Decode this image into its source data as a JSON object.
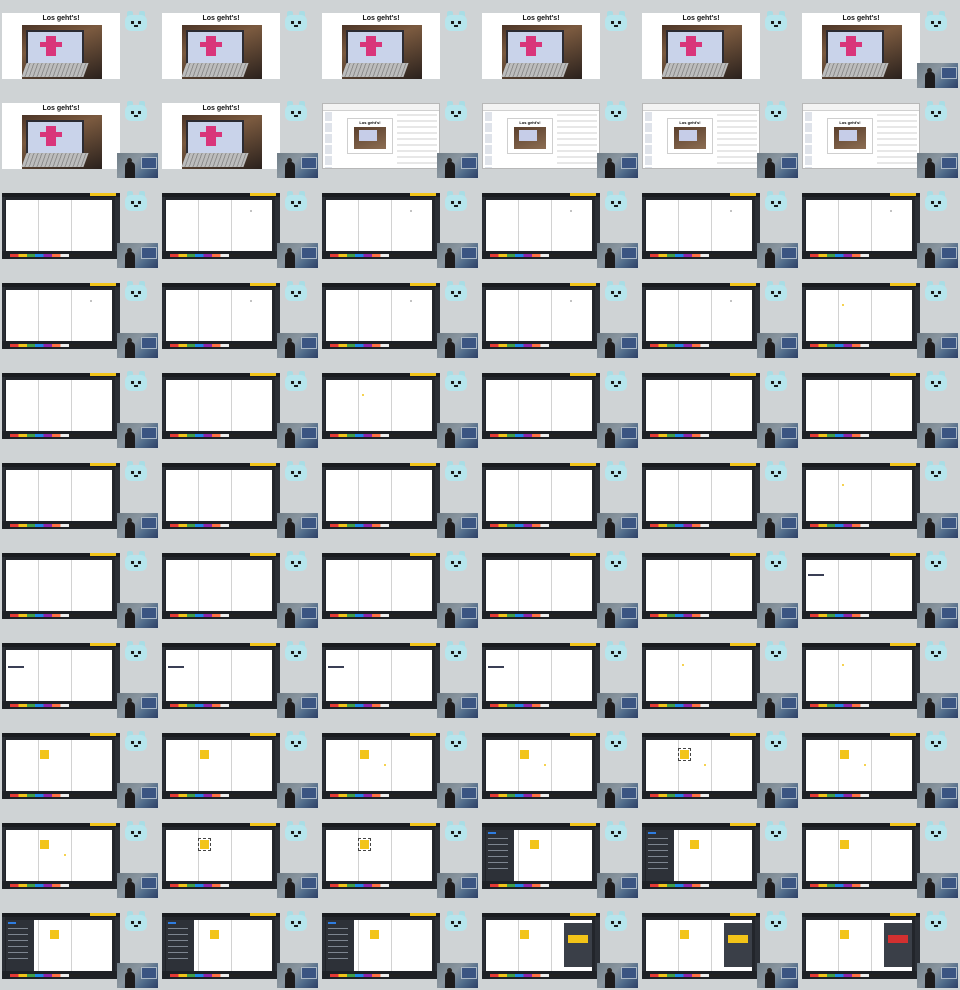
{
  "title_text": "Los geht's!",
  "colors": {
    "background": "#cfd3d5",
    "accent_yellow": "#f2c418",
    "board_dark": "#22252b",
    "mascot": "#b6e5ec",
    "marker_dot": "#b0b0b0",
    "yellow_dot": "#f2c418",
    "dialog_red": "#d23030"
  },
  "grid": {
    "columns": 6,
    "rows": 11,
    "cells": [
      {
        "type": "title",
        "cam": false
      },
      {
        "type": "title",
        "cam": false
      },
      {
        "type": "title",
        "cam": false
      },
      {
        "type": "title",
        "cam": false
      },
      {
        "type": "title",
        "cam": false
      },
      {
        "type": "title",
        "cam": true
      },
      {
        "type": "title",
        "cam": true
      },
      {
        "type": "title",
        "cam": true
      },
      {
        "type": "editor",
        "cam": true
      },
      {
        "type": "editor",
        "cam": true
      },
      {
        "type": "editor",
        "cam": true
      },
      {
        "type": "editor",
        "cam": true
      },
      {
        "type": "board",
        "cam": true
      },
      {
        "type": "board",
        "cam": true,
        "dot": "gray"
      },
      {
        "type": "board",
        "cam": true,
        "dot": "gray"
      },
      {
        "type": "board",
        "cam": true,
        "dot": "gray"
      },
      {
        "type": "board",
        "cam": true,
        "dot": "gray"
      },
      {
        "type": "board",
        "cam": true,
        "dot": "gray"
      },
      {
        "type": "board",
        "cam": true,
        "dot": "gray"
      },
      {
        "type": "board",
        "cam": true,
        "dot": "gray"
      },
      {
        "type": "board",
        "cam": true,
        "dot": "gray"
      },
      {
        "type": "board",
        "cam": true,
        "dot": "gray"
      },
      {
        "type": "board",
        "cam": true,
        "dot": "gray"
      },
      {
        "type": "board",
        "cam": true,
        "dot": "yellow"
      },
      {
        "type": "board",
        "cam": true
      },
      {
        "type": "board",
        "cam": true
      },
      {
        "type": "board",
        "cam": true,
        "dot": "yellow"
      },
      {
        "type": "board",
        "cam": true
      },
      {
        "type": "board",
        "cam": true
      },
      {
        "type": "board",
        "cam": true
      },
      {
        "type": "board",
        "cam": true
      },
      {
        "type": "board",
        "cam": true
      },
      {
        "type": "board",
        "cam": true
      },
      {
        "type": "board",
        "cam": true
      },
      {
        "type": "board",
        "cam": true
      },
      {
        "type": "board",
        "cam": true,
        "dot": "yellow"
      },
      {
        "type": "board",
        "cam": true
      },
      {
        "type": "board",
        "cam": true
      },
      {
        "type": "board",
        "cam": true
      },
      {
        "type": "board",
        "cam": true
      },
      {
        "type": "board",
        "cam": true
      },
      {
        "type": "board",
        "cam": true,
        "stroke": true
      },
      {
        "type": "board",
        "cam": true,
        "stroke": true
      },
      {
        "type": "board",
        "cam": true,
        "stroke": true
      },
      {
        "type": "board",
        "cam": true,
        "stroke": true
      },
      {
        "type": "board",
        "cam": true,
        "stroke": true
      },
      {
        "type": "board",
        "cam": true,
        "dot": "yellow"
      },
      {
        "type": "board",
        "cam": true,
        "dot": "yellow"
      },
      {
        "type": "board",
        "cam": true,
        "square": true
      },
      {
        "type": "board",
        "cam": true,
        "square": true
      },
      {
        "type": "board",
        "cam": true,
        "square": true,
        "dot": "yellow"
      },
      {
        "type": "board",
        "cam": true,
        "square": true,
        "dot": "yellow"
      },
      {
        "type": "board",
        "cam": true,
        "square": "sel",
        "dot": "yellow"
      },
      {
        "type": "board",
        "cam": true,
        "square": true,
        "dot": "yellow"
      },
      {
        "type": "board",
        "cam": true,
        "square": true,
        "dot": "yellow"
      },
      {
        "type": "board",
        "cam": true,
        "square": "sel"
      },
      {
        "type": "board",
        "cam": true,
        "square": "sel"
      },
      {
        "type": "board",
        "cam": true,
        "side": true,
        "square": true
      },
      {
        "type": "board",
        "cam": true,
        "side": true,
        "square": true
      },
      {
        "type": "board",
        "cam": true,
        "square": true
      },
      {
        "type": "board",
        "cam": true,
        "side": true,
        "square": true
      },
      {
        "type": "board",
        "cam": true,
        "side": true,
        "square": true
      },
      {
        "type": "board",
        "cam": true,
        "side": true,
        "square": true
      },
      {
        "type": "board",
        "cam": true,
        "square": true,
        "dialog": "yellow"
      },
      {
        "type": "board",
        "cam": true,
        "square": true,
        "dialog": "yellow"
      },
      {
        "type": "board",
        "cam": true,
        "square": true,
        "dialog": "red"
      }
    ]
  }
}
